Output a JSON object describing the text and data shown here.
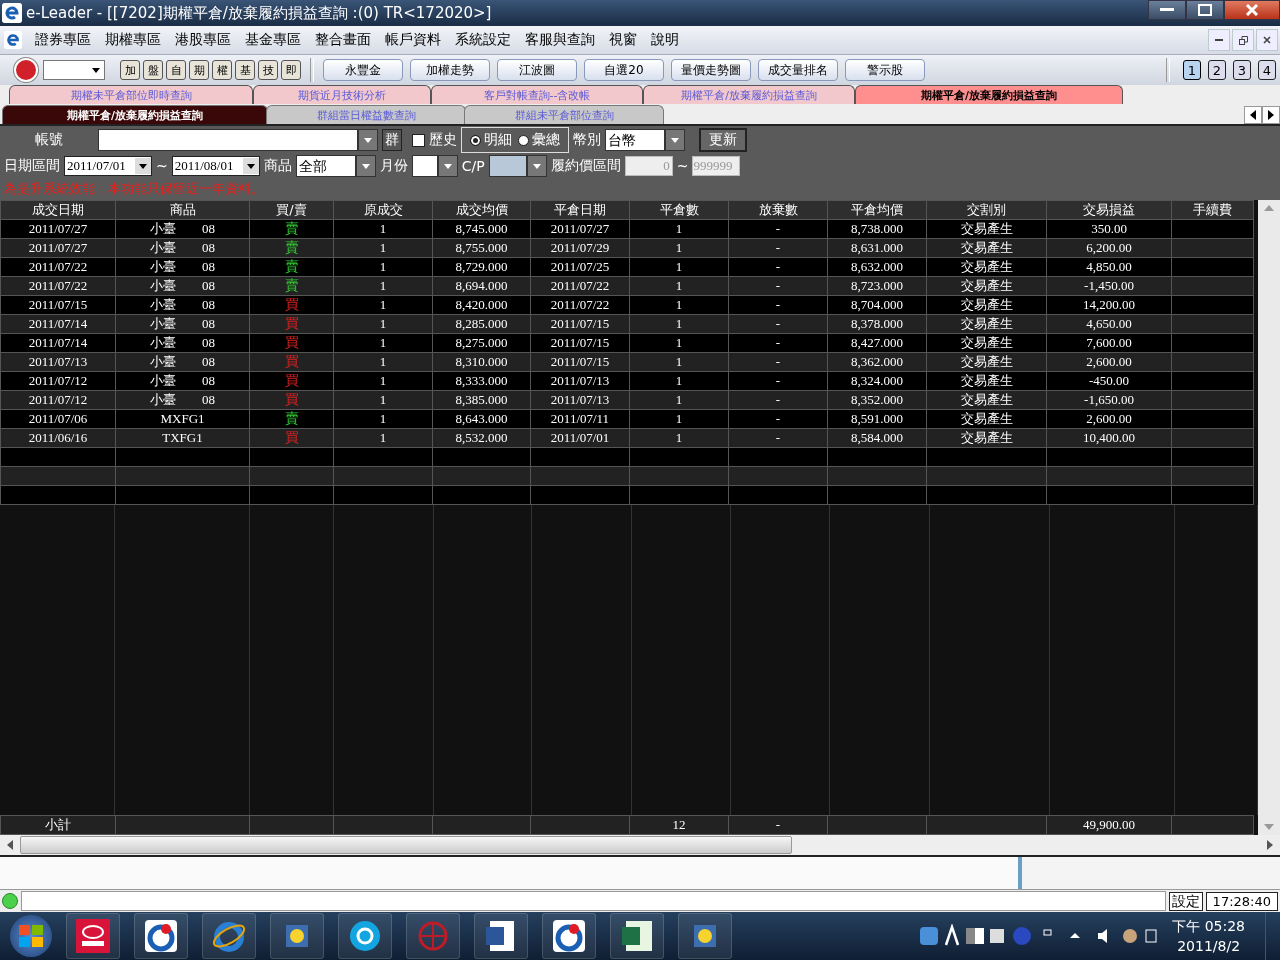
{
  "window": {
    "title": "e-Leader - [[7202]期權平倉/放棄履約損益查詢 :(0) TR<172020>]"
  },
  "menu": [
    "證券專區",
    "期權專區",
    "港股專區",
    "基金專區",
    "整合畫面",
    "帳戶資料",
    "系統設定",
    "客服與查詢",
    "視窗",
    "說明"
  ],
  "toolbar": {
    "glyph_buttons": [
      "加",
      "盤",
      "自",
      "期",
      "權",
      "基",
      "技",
      "即"
    ],
    "quick_buttons": [
      "永豐金",
      "加權走勢",
      "江波圖",
      "自選20",
      "量價走勢圖",
      "成交量排名",
      "警示股"
    ],
    "pages": [
      {
        "label": "1",
        "selected": true
      },
      {
        "label": "2",
        "selected": false
      },
      {
        "label": "3",
        "selected": false
      },
      {
        "label": "4",
        "selected": false
      }
    ]
  },
  "tabs": [
    {
      "label": "期權未平倉部位即時查詢",
      "selected": false
    },
    {
      "label": "期貨近月技術分析",
      "selected": false
    },
    {
      "label": "客戶對帳查詢--含改帳",
      "selected": false
    },
    {
      "label": "期權平倉/放棄履約損益查詢",
      "selected": false
    },
    {
      "label": "期權平倉/放棄履約損益查詢",
      "selected": true
    }
  ],
  "subtabs": [
    {
      "label": "期權平倉/放棄履約損益查詢",
      "selected": true
    },
    {
      "label": "群組當日權益數查詢",
      "selected": false
    },
    {
      "label": "群組未平倉部位查詢",
      "selected": false
    }
  ],
  "filters": {
    "account_label": "帳號",
    "group_button": "群",
    "history": {
      "label": "歷史",
      "checked": false
    },
    "modes": [
      {
        "label": "明細",
        "selected": true
      },
      {
        "label": "彙總",
        "selected": false
      }
    ],
    "currency_label": "幣別",
    "currency": "台幣",
    "refresh": "更新",
    "date_label": "日期區間",
    "date_from": "2011/07/01",
    "date_sep": "~",
    "date_to": "2011/08/01",
    "product_label": "商品",
    "product": "全部",
    "month_label": "月份",
    "cp_label": "C/P",
    "strike_label": "履約價區間",
    "strike_from": "0",
    "strike_sep": "~",
    "strike_to": "999999",
    "notice": "為提升系統效能，本功能只保留近一年資料。"
  },
  "table": {
    "columns": [
      "成交日期",
      "商品",
      "買/賣",
      "原成交",
      "成交均價",
      "平倉日期",
      "平倉數",
      "放棄數",
      "平倉均價",
      "交割別",
      "交易損益",
      "手續費"
    ],
    "rows": [
      {
        "date": "2011/07/27",
        "product": "小臺　　08",
        "side": "賣",
        "kind": "sell",
        "qty": "1",
        "price": "8,745.000",
        "close_date": "2011/07/27",
        "close_qty": "1",
        "waived": "-",
        "close_price": "8,738.000",
        "settle": "交易產生",
        "pnl": "350.00"
      },
      {
        "date": "2011/07/27",
        "product": "小臺　　08",
        "side": "賣",
        "kind": "sell",
        "qty": "1",
        "price": "8,755.000",
        "close_date": "2011/07/29",
        "close_qty": "1",
        "waived": "-",
        "close_price": "8,631.000",
        "settle": "交易產生",
        "pnl": "6,200.00"
      },
      {
        "date": "2011/07/22",
        "product": "小臺　　08",
        "side": "賣",
        "kind": "sell",
        "qty": "1",
        "price": "8,729.000",
        "close_date": "2011/07/25",
        "close_qty": "1",
        "waived": "-",
        "close_price": "8,632.000",
        "settle": "交易產生",
        "pnl": "4,850.00"
      },
      {
        "date": "2011/07/22",
        "product": "小臺　　08",
        "side": "賣",
        "kind": "sell",
        "qty": "1",
        "price": "8,694.000",
        "close_date": "2011/07/22",
        "close_qty": "1",
        "waived": "-",
        "close_price": "8,723.000",
        "settle": "交易產生",
        "pnl": "-1,450.00"
      },
      {
        "date": "2011/07/15",
        "product": "小臺　　08",
        "side": "買",
        "kind": "buy",
        "qty": "1",
        "price": "8,420.000",
        "close_date": "2011/07/22",
        "close_qty": "1",
        "waived": "-",
        "close_price": "8,704.000",
        "settle": "交易產生",
        "pnl": "14,200.00"
      },
      {
        "date": "2011/07/14",
        "product": "小臺　　08",
        "side": "買",
        "kind": "buy",
        "qty": "1",
        "price": "8,285.000",
        "close_date": "2011/07/15",
        "close_qty": "1",
        "waived": "-",
        "close_price": "8,378.000",
        "settle": "交易產生",
        "pnl": "4,650.00"
      },
      {
        "date": "2011/07/14",
        "product": "小臺　　08",
        "side": "買",
        "kind": "buy",
        "qty": "1",
        "price": "8,275.000",
        "close_date": "2011/07/15",
        "close_qty": "1",
        "waived": "-",
        "close_price": "8,427.000",
        "settle": "交易產生",
        "pnl": "7,600.00"
      },
      {
        "date": "2011/07/13",
        "product": "小臺　　08",
        "side": "買",
        "kind": "buy",
        "qty": "1",
        "price": "8,310.000",
        "close_date": "2011/07/15",
        "close_qty": "1",
        "waived": "-",
        "close_price": "8,362.000",
        "settle": "交易產生",
        "pnl": "2,600.00"
      },
      {
        "date": "2011/07/12",
        "product": "小臺　　08",
        "side": "買",
        "kind": "buy",
        "qty": "1",
        "price": "8,333.000",
        "close_date": "2011/07/13",
        "close_qty": "1",
        "waived": "-",
        "close_price": "8,324.000",
        "settle": "交易產生",
        "pnl": "-450.00"
      },
      {
        "date": "2011/07/12",
        "product": "小臺　　08",
        "side": "買",
        "kind": "buy",
        "qty": "1",
        "price": "8,385.000",
        "close_date": "2011/07/13",
        "close_qty": "1",
        "waived": "-",
        "close_price": "8,352.000",
        "settle": "交易產生",
        "pnl": "-1,650.00"
      },
      {
        "date": "2011/07/06",
        "product": "MXFG1",
        "side": "賣",
        "kind": "sell",
        "qty": "1",
        "price": "8,643.000",
        "close_date": "2011/07/11",
        "close_qty": "1",
        "waived": "-",
        "close_price": "8,591.000",
        "settle": "交易產生",
        "pnl": "2,600.00"
      },
      {
        "date": "2011/06/16",
        "product": "TXFG1",
        "side": "買",
        "kind": "buy",
        "qty": "1",
        "price": "8,532.000",
        "close_date": "2011/07/01",
        "close_qty": "1",
        "waived": "-",
        "close_price": "8,584.000",
        "settle": "交易產生",
        "pnl": "10,400.00"
      }
    ],
    "subtotal": {
      "label": "小計",
      "close_qty": "12",
      "waived": "-",
      "pnl": "49,900.00"
    }
  },
  "status": {
    "settings": "設定",
    "time": "17:28:40"
  },
  "taskbar": {
    "time": "下午 05:28",
    "date": "2011/8/2"
  }
}
